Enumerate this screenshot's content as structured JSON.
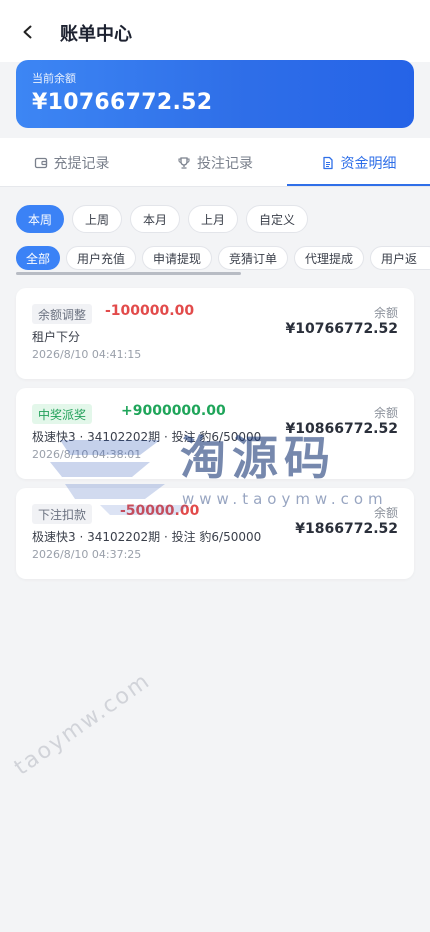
{
  "header": {
    "title": "账单中心",
    "back_icon": "chevron-left-icon"
  },
  "balance": {
    "label": "当前余额",
    "amount": "¥10766772.52"
  },
  "tabs": [
    {
      "label": "充提记录",
      "icon": "wallet-icon",
      "active": false
    },
    {
      "label": "投注记录",
      "icon": "trophy-icon",
      "active": false
    },
    {
      "label": "资金明细",
      "icon": "document-icon",
      "active": true
    }
  ],
  "periods": [
    {
      "label": "本周",
      "active": true
    },
    {
      "label": "上周",
      "active": false
    },
    {
      "label": "本月",
      "active": false
    },
    {
      "label": "上月",
      "active": false
    },
    {
      "label": "自定义",
      "active": false
    }
  ],
  "types": [
    {
      "label": "全部",
      "active": true
    },
    {
      "label": "用户充值",
      "active": false
    },
    {
      "label": "申请提现",
      "active": false
    },
    {
      "label": "竞猜订单",
      "active": false
    },
    {
      "label": "代理提成",
      "active": false
    },
    {
      "label": "用户返",
      "active": false
    }
  ],
  "records": [
    {
      "tag": "余额调整",
      "tag_style": "gray",
      "amount": "-100000.00",
      "sign": "neg",
      "desc": "租户下分",
      "time": "2026/8/10 04:41:15",
      "balance_label": "余额",
      "balance_value": "¥10766772.52"
    },
    {
      "tag": "中奖派奖",
      "tag_style": "green",
      "amount": "+9000000.00",
      "sign": "pos",
      "desc": "极速快3 · 34102202期 · 投注 豹6/50000",
      "time": "2026/8/10 04:38:01",
      "balance_label": "余额",
      "balance_value": "¥10866772.52"
    },
    {
      "tag": "下注扣款",
      "tag_style": "gray",
      "amount": "-50000.00",
      "sign": "neg",
      "desc": "极速快3 · 34102202期 · 投注 豹6/50000",
      "time": "2026/8/10 04:37:25",
      "balance_label": "余额",
      "balance_value": "¥1866772.52"
    }
  ],
  "watermark": {
    "brand": "淘源码",
    "url": "www.taoymw.com",
    "diagonal": "taoymw.com"
  },
  "colors": {
    "accent": "#2f6fe8",
    "negative": "#e24b4b",
    "positive": "#1fa55a"
  }
}
